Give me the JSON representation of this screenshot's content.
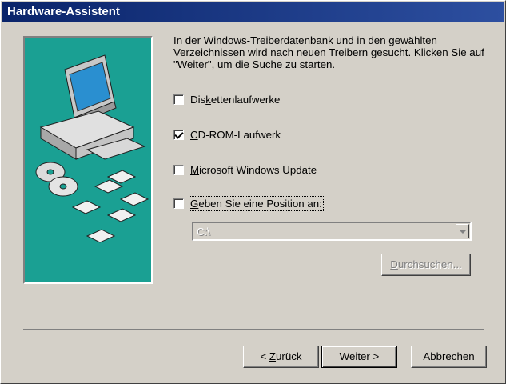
{
  "window": {
    "title": "Hardware-Assistent"
  },
  "intro": "In der Windows-Treiberdatenbank und in den gewählten Verzeichnissen wird nach neuen Treibern gesucht. Klicken Sie auf \"Weiter\", um die Suche zu starten.",
  "options": [
    {
      "pre": "Dis",
      "key": "k",
      "post": "ettenlaufwerke",
      "checked": false
    },
    {
      "pre": "",
      "key": "C",
      "post": "D-ROM-Laufwerk",
      "checked": true
    },
    {
      "pre": "",
      "key": "M",
      "post": "icrosoft Windows Update",
      "checked": false
    },
    {
      "pre": "",
      "key": "G",
      "post": "eben Sie eine Position an:",
      "checked": false
    }
  ],
  "location": {
    "value": "C:\\"
  },
  "buttons": {
    "browse": {
      "key": "D",
      "post": "urchsuchen..."
    },
    "back": {
      "pre": "< ",
      "key": "Z",
      "post": "urück"
    },
    "next": "Weiter >",
    "cancel": "Abbrechen"
  },
  "colors": {
    "title_bg": "#0a246a",
    "art_bg": "#1aa093",
    "face": "#d4d0c8"
  }
}
